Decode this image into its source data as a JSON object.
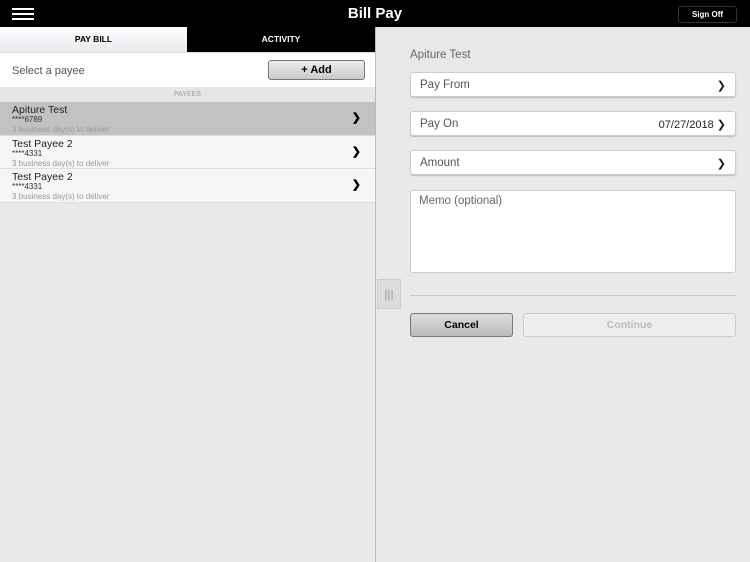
{
  "header": {
    "title": "Bill Pay",
    "sign_off": "Sign Off"
  },
  "tabs": [
    {
      "label": "PAY BILL",
      "active": true
    },
    {
      "label": "ACTIVITY",
      "active": false
    }
  ],
  "select_payee": {
    "label": "Select a payee",
    "add_label": "+ Add"
  },
  "payees_header": "PAYEES",
  "payees": [
    {
      "name": "Apiture Test",
      "account": "****6789",
      "delivery": "3 business day(s) to deliver",
      "selected": true
    },
    {
      "name": "Test Payee 2",
      "account": "****4331",
      "delivery": "3 business day(s) to deliver",
      "selected": false
    },
    {
      "name": "Test Payee 2",
      "account": "****4331",
      "delivery": "3 business day(s) to deliver",
      "selected": false
    }
  ],
  "form": {
    "payee": "Apiture Test",
    "pay_from": "Pay From",
    "pay_on": "Pay On",
    "pay_on_date": "07/27/2018",
    "amount": "Amount",
    "memo_placeholder": "Memo (optional)",
    "cancel": "Cancel",
    "continue": "Continue"
  }
}
